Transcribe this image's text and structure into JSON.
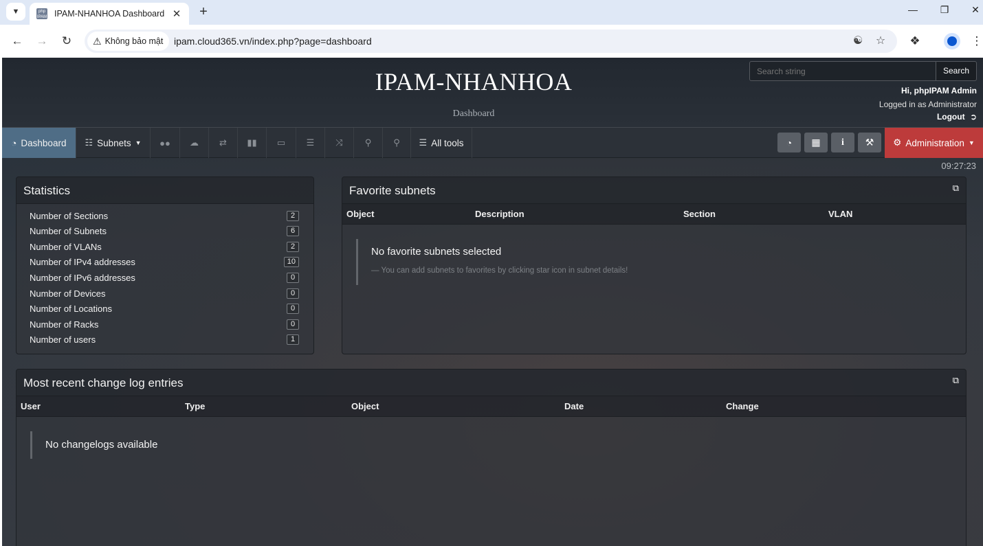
{
  "browser": {
    "tab_title": "IPAM-NHANHOA Dashboard",
    "favicon_text": "php IPAM",
    "security_label": "Không bảo mật",
    "url": "ipam.cloud365.vn/index.php?page=dashboard"
  },
  "header": {
    "title": "IPAM-NHANHOA",
    "subtitle": "Dashboard",
    "search_placeholder": "Search string",
    "search_button": "Search",
    "greeting": "Hi, phpIPAM Admin",
    "logged_in_as": "Logged in as  Administrator",
    "logout": "Logout"
  },
  "nav": {
    "dashboard": "Dashboard",
    "subnets": "Subnets",
    "all_tools": "All tools",
    "administration": "Administration"
  },
  "clock": "09:27:23",
  "statistics": {
    "title": "Statistics",
    "rows": [
      {
        "label": "Number of Sections",
        "value": "2"
      },
      {
        "label": "Number of Subnets",
        "value": "6"
      },
      {
        "label": "Number of VLANs",
        "value": "2"
      },
      {
        "label": "Number of IPv4 addresses",
        "value": "10"
      },
      {
        "label": "Number of IPv6 addresses",
        "value": "0"
      },
      {
        "label": "Number of Devices",
        "value": "0"
      },
      {
        "label": "Number of Locations",
        "value": "0"
      },
      {
        "label": "Number of Racks",
        "value": "0"
      },
      {
        "label": "Number of users",
        "value": "1"
      }
    ]
  },
  "favorites": {
    "title": "Favorite subnets",
    "columns": [
      "Object",
      "Description",
      "Section",
      "VLAN"
    ],
    "empty_title": "No favorite subnets selected",
    "empty_hint": "— You can add subnets to favorites by clicking star icon in subnet details!"
  },
  "changelog": {
    "title": "Most recent change log entries",
    "columns": [
      "User",
      "Type",
      "Object",
      "Date",
      "Change"
    ],
    "empty": "No changelogs available"
  }
}
